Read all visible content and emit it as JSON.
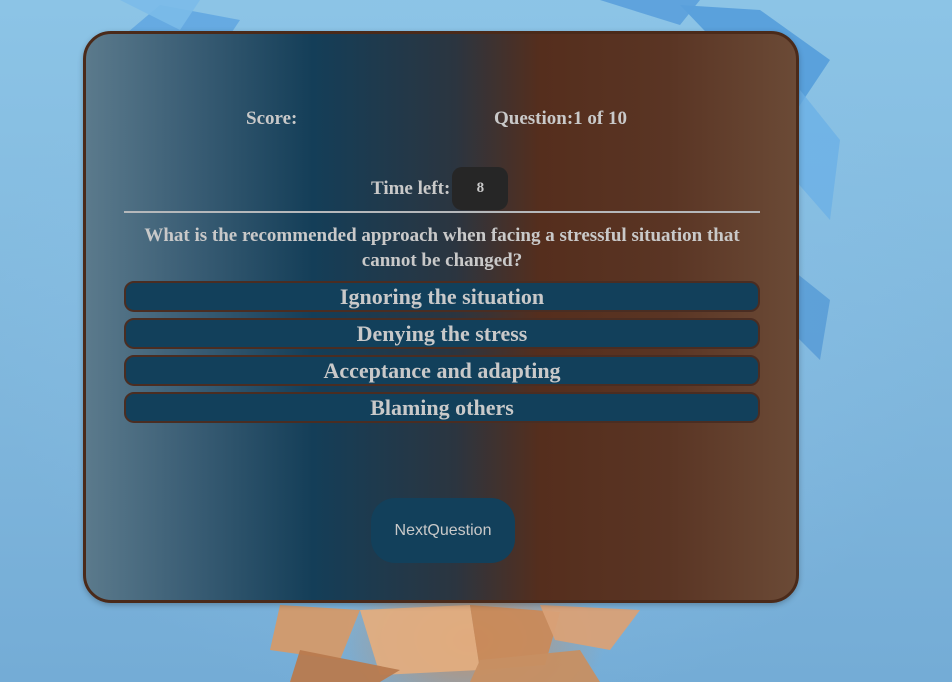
{
  "quiz": {
    "score_label": "Score:",
    "question_label": "Question:1 of 10",
    "time_left_label": "Time left:",
    "time_left_value": "8",
    "question_text": "What is the recommended approach when facing a stressful situation that cannot be changed?",
    "options": [
      "Ignoring the situation",
      "Denying the stress",
      "Acceptance and adapting",
      "Blaming others"
    ],
    "next_button_label": "NextQuestion"
  },
  "colors": {
    "page_background": "#7fb6dc",
    "card_border": "#4a2a1a",
    "option_background": "#12405b",
    "timer_background": "#262626",
    "text": "#c9c9c9"
  }
}
